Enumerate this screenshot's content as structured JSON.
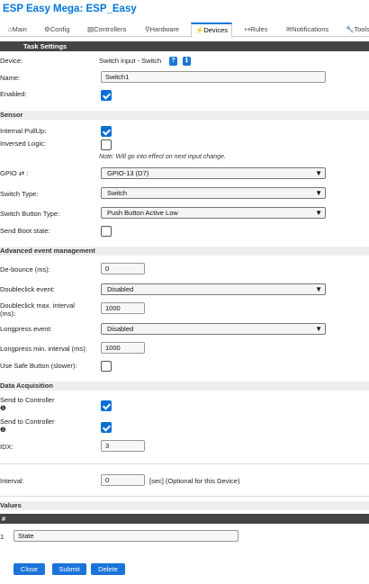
{
  "app_title": "ESP Easy Mega: ESP_Easy",
  "tabs": [
    {
      "icon": "⌂",
      "label": "Main"
    },
    {
      "icon": "⚙",
      "label": "Config"
    },
    {
      "icon": "▤",
      "label": "Controllers"
    },
    {
      "icon": "⚲",
      "label": "Hardware"
    },
    {
      "icon": "⚡",
      "label": "Devices"
    },
    {
      "icon": "↦",
      "label": "Rules"
    },
    {
      "icon": "✉",
      "label": "Notifications"
    },
    {
      "icon": "🔧",
      "label": "Tools"
    }
  ],
  "active_tab": "Devices",
  "task_settings": {
    "header": "Task Settings",
    "device_label": "Device:",
    "device_value": "Switch input - Switch",
    "help_icon": "?",
    "info_icon": "ℹ",
    "name_label": "Name:",
    "name_value": "Switch1",
    "enabled_label": "Enabled:",
    "enabled": true
  },
  "sensor": {
    "header": "Sensor",
    "pullup_label": "Internal PullUp:",
    "pullup": true,
    "inversed_label": "Inversed Logic:",
    "inversed": false,
    "note": "Note: Will go into effect on next input change.",
    "gpio_label": "GPIO ⇄ :",
    "gpio_value": "GPIO-13 (D7)",
    "switch_type_label": "Switch Type:",
    "switch_type_value": "Switch",
    "switch_button_type_label": "Switch Button Type:",
    "switch_button_type_value": "Push Button Active Low",
    "send_boot_label": "Send Boot state:",
    "send_boot": false
  },
  "advanced": {
    "header": "Advanced event management",
    "debounce_label": "De-bounce (ms):",
    "debounce_value": "0",
    "doubleclick_label": "Doubleclick event:",
    "doubleclick_value": "Disabled",
    "doubleclick_interval_label_1": "Doubleclick max. interval",
    "doubleclick_interval_label_2": "(ms):",
    "doubleclick_interval_value": "1000",
    "longpress_label": "Longpress event:",
    "longpress_value": "Disabled",
    "longpress_interval_label": "Longpress min. interval (ms):",
    "longpress_interval_value": "1000",
    "safe_button_label": "Use Safe Button (slower):",
    "safe_button": false
  },
  "acquisition": {
    "header": "Data Acquisition",
    "send1_label": "Send to Controller",
    "send1_num": "❶",
    "send1": true,
    "send2_label": "Send to Controller",
    "send2_num": "❷",
    "send2": true,
    "idx_label": "IDX:",
    "idx_value": "3",
    "interval_label": "Interval:",
    "interval_value": "0",
    "interval_note": "[sec] (Optional for this Device)"
  },
  "values": {
    "header": "Values",
    "col_hash": "#",
    "row_num": "1",
    "row_value": "State"
  },
  "buttons": {
    "close": "Close",
    "submit": "Submit",
    "delete": "Delete"
  },
  "colors": {
    "accent": "#0077dd",
    "button": "#1a73d9",
    "header_dark": "#444444",
    "header_light": "#eeeeee"
  }
}
